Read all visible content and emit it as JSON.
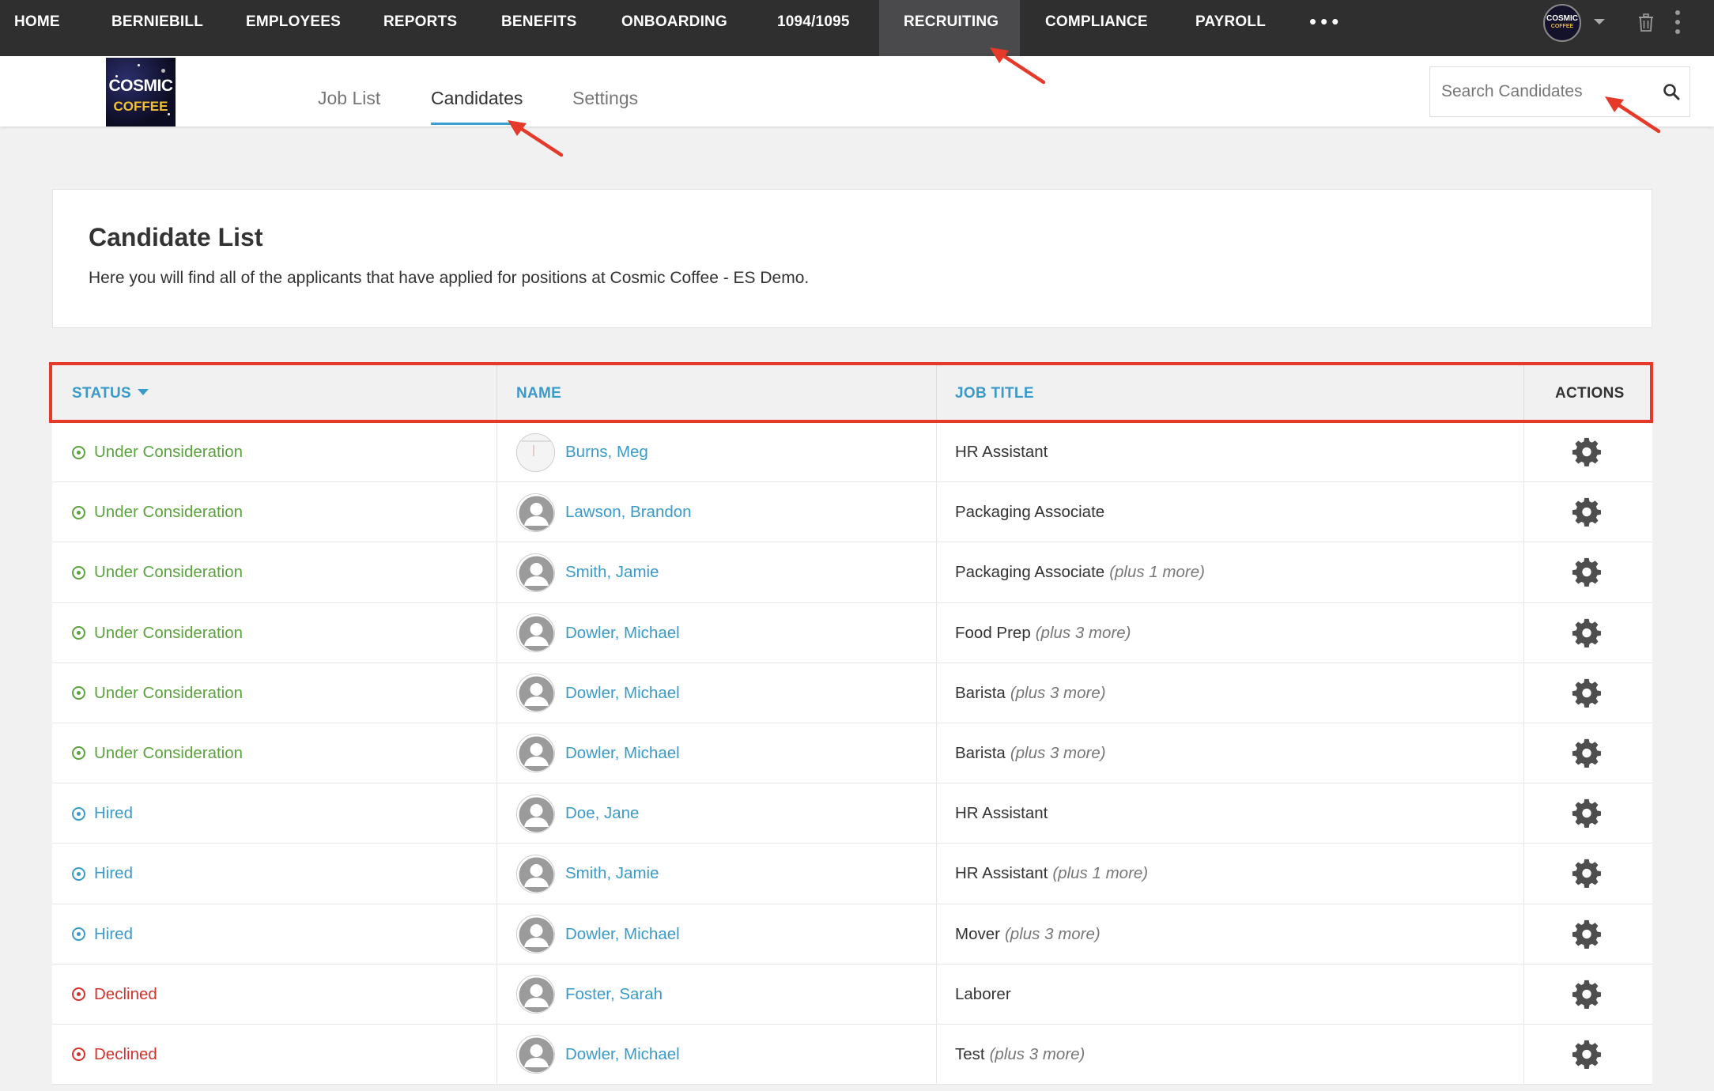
{
  "topnav": {
    "items": [
      {
        "label": "HOME",
        "active": false
      },
      {
        "label": "BERNIEBILL",
        "active": false
      },
      {
        "label": "EMPLOYEES",
        "active": false
      },
      {
        "label": "REPORTS",
        "active": false
      },
      {
        "label": "BENEFITS",
        "active": false
      },
      {
        "label": "ONBOARDING",
        "active": false
      },
      {
        "label": "1094/1095",
        "active": false
      },
      {
        "label": "RECRUITING",
        "active": true
      },
      {
        "label": "COMPLIANCE",
        "active": false
      },
      {
        "label": "PAYROLL",
        "active": false
      }
    ],
    "more_label": "•••",
    "company_avatar": {
      "line1": "COSMIC",
      "line2": "COFFEE"
    },
    "icons": [
      "chevron-down-icon",
      "trash-icon",
      "kebab-icon"
    ]
  },
  "subnav": {
    "logo": {
      "line1": "COSMIC",
      "line2": "COFFEE"
    },
    "tabs": [
      {
        "label": "Job List",
        "active": false
      },
      {
        "label": "Candidates",
        "active": true
      },
      {
        "label": "Settings",
        "active": false
      }
    ],
    "search": {
      "placeholder": "Search Candidates",
      "value": ""
    }
  },
  "card": {
    "title": "Candidate List",
    "description": "Here you will find all of the applicants that have applied for positions at Cosmic Coffee - ES Demo."
  },
  "table": {
    "columns": {
      "status": "STATUS",
      "name": "NAME",
      "job_title": "JOB TITLE",
      "actions": "ACTIONS"
    },
    "sort": {
      "column": "status",
      "direction": "descending"
    },
    "rows": [
      {
        "status": "Under Consideration",
        "status_type": "consideration",
        "name": "Burns, Meg",
        "photo": true,
        "job": "HR Assistant",
        "more": ""
      },
      {
        "status": "Under Consideration",
        "status_type": "consideration",
        "name": "Lawson, Brandon",
        "photo": false,
        "job": "Packaging Associate",
        "more": ""
      },
      {
        "status": "Under Consideration",
        "status_type": "consideration",
        "name": "Smith, Jamie",
        "photo": false,
        "job": "Packaging Associate",
        "more": "(plus 1 more)"
      },
      {
        "status": "Under Consideration",
        "status_type": "consideration",
        "name": "Dowler, Michael",
        "photo": false,
        "job": "Food Prep",
        "more": "(plus 3 more)"
      },
      {
        "status": "Under Consideration",
        "status_type": "consideration",
        "name": "Dowler, Michael",
        "photo": false,
        "job": "Barista",
        "more": "(plus 3 more)"
      },
      {
        "status": "Under Consideration",
        "status_type": "consideration",
        "name": "Dowler, Michael",
        "photo": false,
        "job": "Barista",
        "more": "(plus 3 more)"
      },
      {
        "status": "Hired",
        "status_type": "hired",
        "name": "Doe, Jane",
        "photo": false,
        "job": "HR Assistant",
        "more": ""
      },
      {
        "status": "Hired",
        "status_type": "hired",
        "name": "Smith, Jamie",
        "photo": false,
        "job": "HR Assistant",
        "more": "(plus 1 more)"
      },
      {
        "status": "Hired",
        "status_type": "hired",
        "name": "Dowler, Michael",
        "photo": false,
        "job": "Mover",
        "more": "(plus 3 more)"
      },
      {
        "status": "Declined",
        "status_type": "declined",
        "name": "Foster, Sarah",
        "photo": false,
        "job": "Laborer",
        "more": ""
      },
      {
        "status": "Declined",
        "status_type": "declined",
        "name": "Dowler, Michael",
        "photo": false,
        "job": "Test",
        "more": "(plus 3 more)"
      }
    ]
  },
  "colors": {
    "topnav_bg": "#2f2f30",
    "link": "#3a9ac9",
    "consideration": "#5aa33f",
    "hired": "#3a9ac9",
    "declined": "#d0342c",
    "annotation": "#e53a2a"
  }
}
